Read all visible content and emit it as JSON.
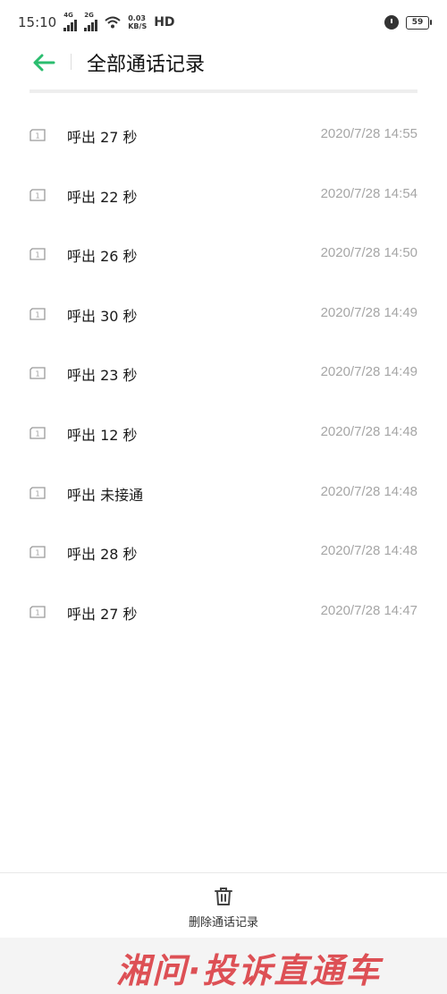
{
  "status_bar": {
    "time": "15:10",
    "network_1": "4G",
    "network_2": "2G",
    "speed_value": "0.03",
    "speed_unit": "KB/S",
    "hd": "HD",
    "battery": "59"
  },
  "header": {
    "title": "全部通话记录",
    "accent_color": "#2bbd6f"
  },
  "calls": [
    {
      "sim": "1",
      "label": "呼出 27 秒",
      "time": "2020/7/28 14:55"
    },
    {
      "sim": "1",
      "label": "呼出 22 秒",
      "time": "2020/7/28 14:54"
    },
    {
      "sim": "1",
      "label": "呼出 26 秒",
      "time": "2020/7/28 14:50"
    },
    {
      "sim": "1",
      "label": "呼出 30 秒",
      "time": "2020/7/28 14:49"
    },
    {
      "sim": "1",
      "label": "呼出 23 秒",
      "time": "2020/7/28 14:49"
    },
    {
      "sim": "1",
      "label": "呼出 12 秒",
      "time": "2020/7/28 14:48"
    },
    {
      "sim": "1",
      "label": "呼出 未接通",
      "time": "2020/7/28 14:48"
    },
    {
      "sim": "1",
      "label": "呼出 28 秒",
      "time": "2020/7/28 14:48"
    },
    {
      "sim": "1",
      "label": "呼出 27 秒",
      "time": "2020/7/28 14:47"
    }
  ],
  "footer": {
    "delete_label": "删除通话记录"
  },
  "watermark": {
    "text": "湘问·投诉直通车",
    "color": "#d9343a"
  }
}
